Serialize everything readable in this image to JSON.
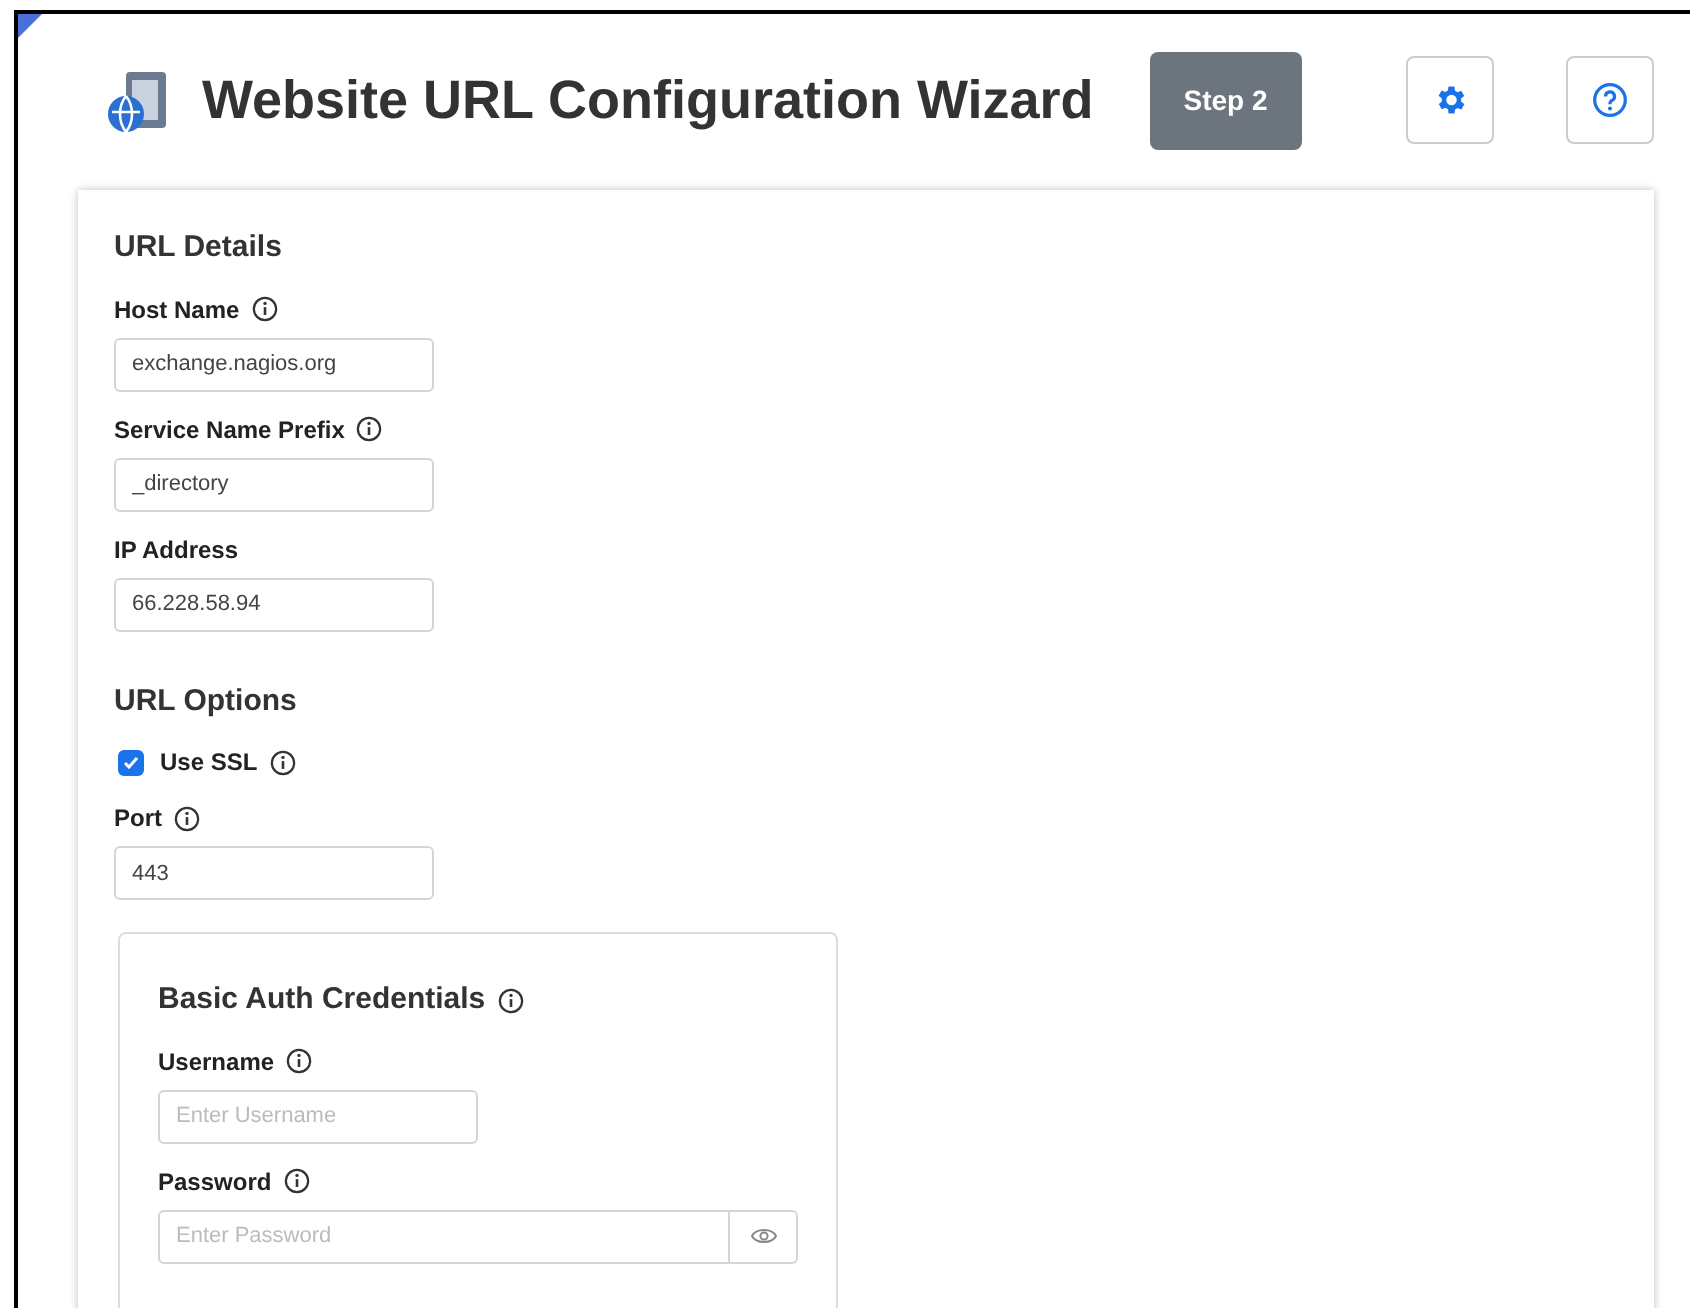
{
  "header": {
    "title": "Website URL Configuration Wizard",
    "step": "Step 2"
  },
  "sections": [
    {
      "title": "URL Details",
      "items": [
        {
          "kind": "field",
          "label": "Host Name",
          "info": true,
          "value": "exchange.nagios.org"
        },
        {
          "kind": "field",
          "label": "Service Name Prefix",
          "info": true,
          "value": "_directory"
        },
        {
          "kind": "field",
          "label": "IP Address",
          "info": false,
          "value": "66.228.58.94"
        }
      ]
    },
    {
      "title": "URL Options",
      "items": [
        {
          "kind": "checkbox",
          "label": "Use SSL",
          "info": true,
          "checked": true
        },
        {
          "kind": "field",
          "label": "Port",
          "info": true,
          "value": "443"
        }
      ]
    }
  ],
  "credentials": {
    "title": "Basic Auth Credentials",
    "info": true,
    "items": [
      {
        "kind": "field",
        "label": "Username",
        "info": true,
        "placeholder": "Enter Username"
      },
      {
        "kind": "password",
        "label": "Password",
        "info": true,
        "placeholder": "Enter Password"
      }
    ]
  }
}
